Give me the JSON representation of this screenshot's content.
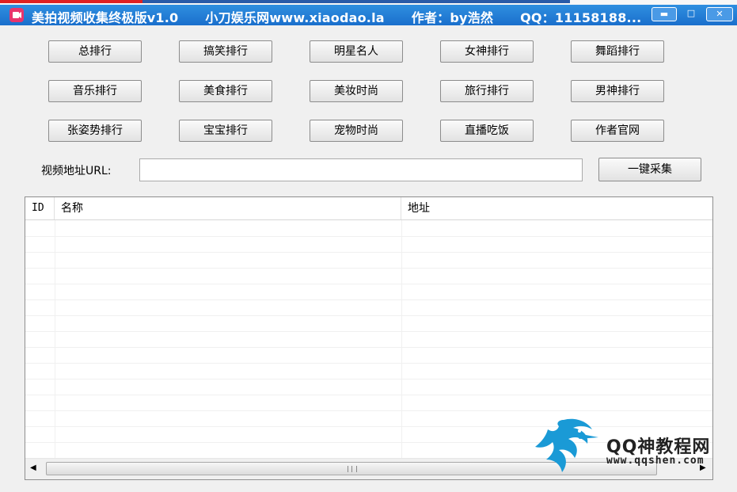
{
  "window": {
    "title_parts": [
      "美拍视频收集终极版v1.0",
      "小刀娱乐网www.xiaodao.la",
      "作者：by浩然",
      "QQ：11158188..."
    ],
    "minimize": "▬",
    "maximize": "□",
    "close": "✕"
  },
  "categories": [
    [
      "总排行",
      "搞笑排行",
      "明星名人",
      "女神排行",
      "舞蹈排行"
    ],
    [
      "音乐排行",
      "美食排行",
      "美妆时尚",
      "旅行排行",
      "男神排行"
    ],
    [
      "张姿势排行",
      "宝宝排行",
      "宠物时尚",
      "直播吃饭",
      "作者官网"
    ]
  ],
  "url": {
    "label": "视频地址URL:",
    "value": "",
    "collect_button": "一键采集"
  },
  "list": {
    "columns": [
      "ID",
      "名称",
      "地址"
    ],
    "rows": []
  },
  "watermark": {
    "title": "QQ神教程网",
    "url": "www.qqshen.com"
  },
  "colors": {
    "titlebar": "#1a6fcc",
    "app_icon": "#e8356d",
    "dragon": "#1a9ad6"
  }
}
